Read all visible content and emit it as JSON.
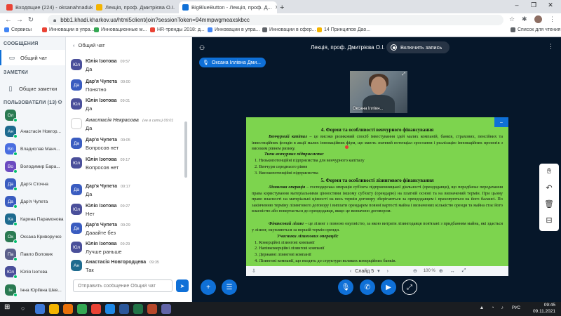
{
  "colors": {
    "brand": "#0f70d7",
    "main_bg": "#06172a",
    "slide_bg": "#7dd44e",
    "online_dot": "#00bf6f"
  },
  "browser": {
    "tabs": [
      {
        "title": "Входящие (224) - oksanahnaduk",
        "favicon": "gmail-icon",
        "color": "#ea4335"
      },
      {
        "title": "Лекція, проф. Дмитрієва О.І.",
        "favicon": "folder-icon",
        "color": "#f4b400"
      },
      {
        "title": "Лекція, проф. Дм...",
        "favicon": "folder-icon",
        "color": "#f4b400"
      },
      {
        "title": "BigBlueButton - Лекція, проф. Д...",
        "favicon": "bbb-icon",
        "color": "#0f70d7"
      }
    ],
    "new_tab": "+",
    "url": "bbb1.khadi.kharkov.ua/html5client/join?sessionToken=94mmpwgmeaxskbcc",
    "bookmarks": [
      {
        "label": "Сервисы",
        "color": "#4285f4"
      },
      {
        "label": "Инновации в упра...",
        "color": "#ea4335"
      },
      {
        "label": "Инновационные м...",
        "color": "#34a853"
      },
      {
        "label": "HR-тренды 2018: д...",
        "color": "#ea4335"
      },
      {
        "label": "Инновации в упра...",
        "color": "#4285f4"
      },
      {
        "label": "Инновации в сфер...",
        "color": "#5f6368"
      },
      {
        "label": "14 Принципов Дао...",
        "color": "#f4b400"
      },
      {
        "label": "Список для чтения",
        "color": "#5f6368"
      }
    ]
  },
  "leftnav": {
    "messages_title": "СООБЩЕНИЯ",
    "public_chat": "Общий чат",
    "notes_title": "ЗАМЕТКИ",
    "shared_notes": "Общие заметки",
    "users_title": "ПОЛЬЗОВАТЕЛИ (13)",
    "users": [
      {
        "initials": "Ол",
        "name": "",
        "color": "#2a7a52"
      },
      {
        "initials": "Ан",
        "name": "Анастасія Новгор...",
        "color": "#1e6b8f"
      },
      {
        "initials": "Вл",
        "name": "Владислав Манч...",
        "color": "#4a6ee0"
      },
      {
        "initials": "Во",
        "name": "Володимир Бара...",
        "color": "#6b4ac0"
      },
      {
        "initials": "Да",
        "name": "Дар'я Сточна",
        "color": "#3a5cc0"
      },
      {
        "initials": "Да",
        "name": "Дар'я Чупета",
        "color": "#3a5cc0"
      },
      {
        "initials": "Ка",
        "name": "Карина Парамонова",
        "color": "#1e6b8f"
      },
      {
        "initials": "Ок",
        "name": "Оксана Криворучко",
        "color": "#2a7a52"
      },
      {
        "initials": "Па",
        "name": "Павло Воловик",
        "color": "#5a5f8a"
      },
      {
        "initials": "Юл",
        "name": "Юлія Ізотова",
        "color": "#4a4f9a"
      },
      {
        "initials": "Ін",
        "name": "Інна Юріївна Шев...",
        "color": "#2a7a52"
      }
    ]
  },
  "chat": {
    "title": "Общий чат",
    "messages": [
      {
        "initials": "Юл",
        "author": "Юлія Ізотова",
        "time": "09:57",
        "text": "Да",
        "color": "#4a4f9a",
        "away": false
      },
      {
        "initials": "Да",
        "author": "Дар'я Чупета",
        "time": "09:00",
        "text": "Понятно",
        "color": "#3a5cc0",
        "away": false
      },
      {
        "initials": "Юл",
        "author": "Юлія Ізотова",
        "time": "09:01",
        "text": "Да",
        "color": "#4a4f9a",
        "away": false
      },
      {
        "initials": "",
        "author": "Анастасія Некрасова",
        "time": "(не в сети) 09:01",
        "text": "Да",
        "color": "#ffffff",
        "away": true
      },
      {
        "initials": "Да",
        "author": "Дар'я Чупета",
        "time": "09:05",
        "text": "Вопросов нет",
        "color": "#3a5cc0",
        "away": false
      },
      {
        "initials": "Юл",
        "author": "Юлія Ізотова",
        "time": "09:17",
        "text": "Вопросов нет",
        "color": "#4a4f9a",
        "away": false
      },
      {
        "initials": "Да",
        "author": "Дар'я Чупета",
        "time": "09:17",
        "text": "Да",
        "color": "#3a5cc0",
        "away": false
      },
      {
        "initials": "Юл",
        "author": "Юлія Ізотова",
        "time": "09:27",
        "text": "Нет",
        "color": "#4a4f9a",
        "away": false
      },
      {
        "initials": "Да",
        "author": "Дар'я Чупета",
        "time": "09:29",
        "text": "Дааайте без",
        "color": "#3a5cc0",
        "away": false
      },
      {
        "initials": "Юл",
        "author": "Юлія Ізотова",
        "time": "09:29",
        "text": "Лучше раньше",
        "color": "#4a4f9a",
        "away": false
      },
      {
        "initials": "Ан",
        "author": "Анастасія Новгородцева",
        "time": "09:35",
        "text": "Так",
        "color": "#1e6b8f",
        "away": false
      }
    ],
    "input_placeholder": "Отправить сообщение Общий чат"
  },
  "main": {
    "title": "Лекція, проф. Дмитрієва О.І.",
    "record_label": "Включить запись",
    "talking_user": "Оксана Іллівна Дми...",
    "webcam_label": "Оксана Іллівн...",
    "slide_label": "Слайд 5",
    "zoom_label": "100 %"
  },
  "slide": {
    "h1": "4. Форми та особливості венчурного фінансування",
    "p1_term": "Венчурний капітал",
    "p1": " – це високо ризиковий спосіб інвестування ідей малих компаній, банків, страхових, пенсійних та інвестиційних фондів в акції малих інноваційних фірм, що мають значний потенціал зростання і реалізацію інноваційних проектів з високим рівнем ризику.",
    "sub1": "Типи венчурних підприємств:",
    "list1": [
      "1.   Низькопотенційні підприємства для венчурного капіталу",
      "2.   Венчури середнього рівня",
      "3.   Високопотенційні підприємства"
    ],
    "h2": "5. Форми та особливості лізингового фінансування",
    "p2_term": "Лізингова операція",
    "p2": " – господарська операція суб'єкта підприємницької діяльності (орендодавця), що передбачає передачання права користування матеріальними цінностями іншому суб'єкту (орендарю) на платній основі та на визначений термін. При цьому право власності на матеріальні цінності на весь термін договору зберігаються за орендодавцем і враховуються на його балансі. По закінченню терміну лізингового договору і виплати орендарем повної вартості майна і визначених кількістю оренди та майна стає його власністю або повертається до орендодавця, якщо це визначено договором.",
    "p3_term": "Фінансовий лізинг",
    "p3": " – це лізинг з повною окупністю, за якою витрати лізингодавця пов'язані з придбанням майна, які здається у лізинг, окупляються за першій термін оренди.",
    "sub2": "Учасники лізингових операцій:",
    "list2": [
      "1.   Комерційні лізингові компанії",
      "2.   Напівкомерційні лізингові компанії",
      "3.   Державні лізингові компанії",
      "4.   Лізингові компанії, що входять до структури великих комерційних банків."
    ]
  },
  "taskbar": {
    "time": "09:45",
    "date": "09.11.2021",
    "lang": "РУС",
    "apps": [
      {
        "color": "#3c78d8"
      },
      {
        "color": "#f4b400"
      },
      {
        "color": "#e8710a"
      },
      {
        "color": "#34a853"
      },
      {
        "color": "#ea4335"
      },
      {
        "color": "#1e88e5"
      },
      {
        "color": "#2b579a"
      },
      {
        "color": "#217346"
      },
      {
        "color": "#b7472a"
      },
      {
        "color": "#6264a7"
      }
    ]
  }
}
